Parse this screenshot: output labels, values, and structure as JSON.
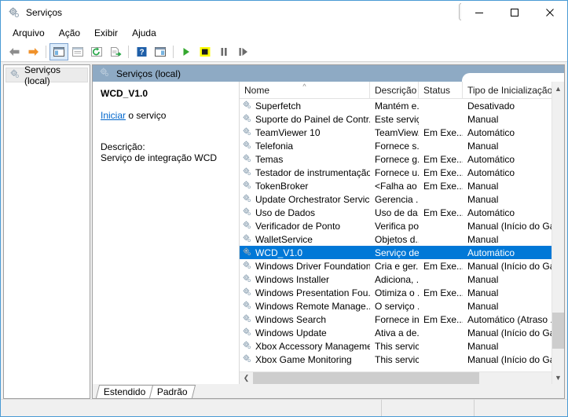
{
  "window": {
    "title": "Serviços",
    "icon": "services-gear-icon",
    "buttons": {
      "resize_cursor": "resize-horizontal-cursor",
      "minimize": "minimize-button",
      "maximize": "maximize-button",
      "close": "close-button"
    }
  },
  "menu": {
    "items": [
      {
        "label": "Arquivo",
        "name": "menu-arquivo"
      },
      {
        "label": "Ação",
        "name": "menu-acao"
      },
      {
        "label": "Exibir",
        "name": "menu-exibir"
      },
      {
        "label": "Ajuda",
        "name": "menu-ajuda"
      }
    ]
  },
  "toolbar": {
    "buttons": [
      {
        "name": "back-button",
        "icon": "arrow-left-icon"
      },
      {
        "name": "forward-button",
        "icon": "arrow-right-icon"
      },
      {
        "name": "show-hide-tree-button",
        "icon": "console-tree-icon"
      },
      {
        "name": "properties-button",
        "icon": "properties-icon"
      },
      {
        "name": "refresh-button",
        "icon": "refresh-icon"
      },
      {
        "name": "export-list-button",
        "icon": "export-list-icon"
      },
      {
        "name": "help-button",
        "icon": "help-icon"
      },
      {
        "name": "show-action-pane-button",
        "icon": "action-pane-icon"
      },
      {
        "name": "start-service-button",
        "icon": "play-icon"
      },
      {
        "name": "stop-service-button",
        "icon": "stop-icon"
      },
      {
        "name": "pause-service-button",
        "icon": "pause-icon"
      },
      {
        "name": "restart-service-button",
        "icon": "restart-icon"
      }
    ]
  },
  "sidebar": {
    "root": {
      "label": "Serviços (local)",
      "icon": "services-gear-icon"
    }
  },
  "pane": {
    "header": {
      "label": "Serviços (local)",
      "icon": "services-gear-icon"
    }
  },
  "details": {
    "service_name": "WCD_V1.0",
    "action_link": "Iniciar",
    "action_suffix": " o serviço",
    "description_label": "Descrição:",
    "description_text": "Serviço de integração WCD"
  },
  "list": {
    "columns": [
      {
        "label": "Nome",
        "name": "column-nome",
        "sorted": true
      },
      {
        "label": "Descrição",
        "name": "column-descricao",
        "sorted": false
      },
      {
        "label": "Status",
        "name": "column-status",
        "sorted": false
      },
      {
        "label": "Tipo de Inicialização",
        "name": "column-tipo-inicializacao",
        "sorted": false
      }
    ],
    "rows": [
      {
        "name": "Superfetch",
        "desc": "Mantém e...",
        "status": "",
        "start": "Desativado",
        "selected": false
      },
      {
        "name": "Suporte do Painel de Contr...",
        "desc": "Este serviç...",
        "status": "",
        "start": "Manual",
        "selected": false
      },
      {
        "name": "TeamViewer 10",
        "desc": "TeamView...",
        "status": "Em Exe...",
        "start": "Automático",
        "selected": false
      },
      {
        "name": "Telefonia",
        "desc": "Fornece s...",
        "status": "",
        "start": "Manual",
        "selected": false
      },
      {
        "name": "Temas",
        "desc": "Fornece g...",
        "status": "Em Exe...",
        "start": "Automático",
        "selected": false
      },
      {
        "name": "Testador de instrumentação...",
        "desc": "Fornece u...",
        "status": "Em Exe...",
        "start": "Automático",
        "selected": false
      },
      {
        "name": "TokenBroker",
        "desc": "<Falha ao ...",
        "status": "Em Exe...",
        "start": "Manual",
        "selected": false
      },
      {
        "name": "Update Orchestrator Service",
        "desc": "Gerencia ...",
        "status": "",
        "start": "Manual",
        "selected": false
      },
      {
        "name": "Uso de Dados",
        "desc": "Uso de da...",
        "status": "Em Exe...",
        "start": "Automático",
        "selected": false
      },
      {
        "name": "Verificador de Ponto",
        "desc": "Verifica po...",
        "status": "",
        "start": "Manual (Início do Ga...",
        "selected": false
      },
      {
        "name": "WalletService",
        "desc": "Objetos d...",
        "status": "",
        "start": "Manual",
        "selected": false
      },
      {
        "name": "WCD_V1.0",
        "desc": "Serviço de...",
        "status": "",
        "start": "Automático",
        "selected": true
      },
      {
        "name": "Windows Driver Foundation...",
        "desc": "Cria e ger...",
        "status": "Em Exe...",
        "start": "Manual (Início do Ga...",
        "selected": false
      },
      {
        "name": "Windows Installer",
        "desc": "Adiciona, ...",
        "status": "",
        "start": "Manual",
        "selected": false
      },
      {
        "name": "Windows Presentation Fou...",
        "desc": "Otimiza o ...",
        "status": "Em Exe...",
        "start": "Manual",
        "selected": false
      },
      {
        "name": "Windows Remote Manage...",
        "desc": "O serviço ...",
        "status": "",
        "start": "Manual",
        "selected": false
      },
      {
        "name": "Windows Search",
        "desc": "Fornece in...",
        "status": "Em Exe...",
        "start": "Automático (Atraso ...",
        "selected": false
      },
      {
        "name": "Windows Update",
        "desc": "Ativa a de...",
        "status": "",
        "start": "Manual (Início do Ga...",
        "selected": false
      },
      {
        "name": "Xbox Accessory Manageme...",
        "desc": "This servic...",
        "status": "",
        "start": "Manual",
        "selected": false
      },
      {
        "name": "Xbox Game Monitoring",
        "desc": "This servic...",
        "status": "",
        "start": "Manual (Início do Ga...",
        "selected": false
      }
    ]
  },
  "tabs": [
    {
      "label": "Estendido",
      "name": "tab-estendido",
      "active": false
    },
    {
      "label": "Padrão",
      "name": "tab-padrao",
      "active": true
    }
  ],
  "colors": {
    "selection": "#0078d7",
    "pane_header": "#8eaac4",
    "link": "#0066cc",
    "window_border": "#4a9ad4",
    "stop_highlight": "#ffff00"
  }
}
